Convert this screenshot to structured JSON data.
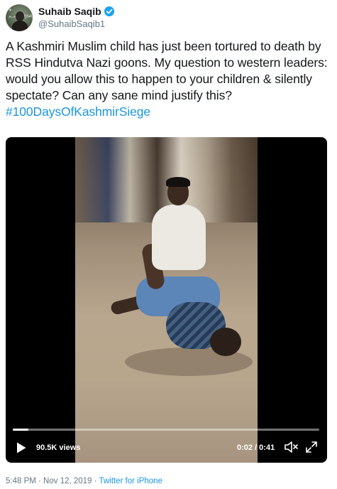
{
  "author": {
    "name": "Suhaib Saqib",
    "handle": "@SuhaibSaqib1",
    "avatar_icon": "profile-photo",
    "verified_icon": "verified-badge-icon",
    "verified_color": "#1da1f2"
  },
  "tweet": {
    "text": "A Kashmiri Muslim child has just been tortured to death by RSS Hindutva Nazi goons. My question to western leaders: would you allow this to happen to your children & silently spectate? Can any sane mind justify this? ",
    "hashtag": "#100DaysOfKashmirSiege",
    "link_color": "#1b95e0"
  },
  "video": {
    "views": "90.5K views",
    "time": "0:02 / 0:41",
    "progress": 0.05,
    "play_icon": "play-icon",
    "mute_icon": "speaker-muted-icon",
    "fullscreen_icon": "fullscreen-icon"
  },
  "meta": {
    "timestamp": "5:48 PM · Nov 12, 2019",
    "separator": " · ",
    "source": "Twitter for iPhone"
  }
}
